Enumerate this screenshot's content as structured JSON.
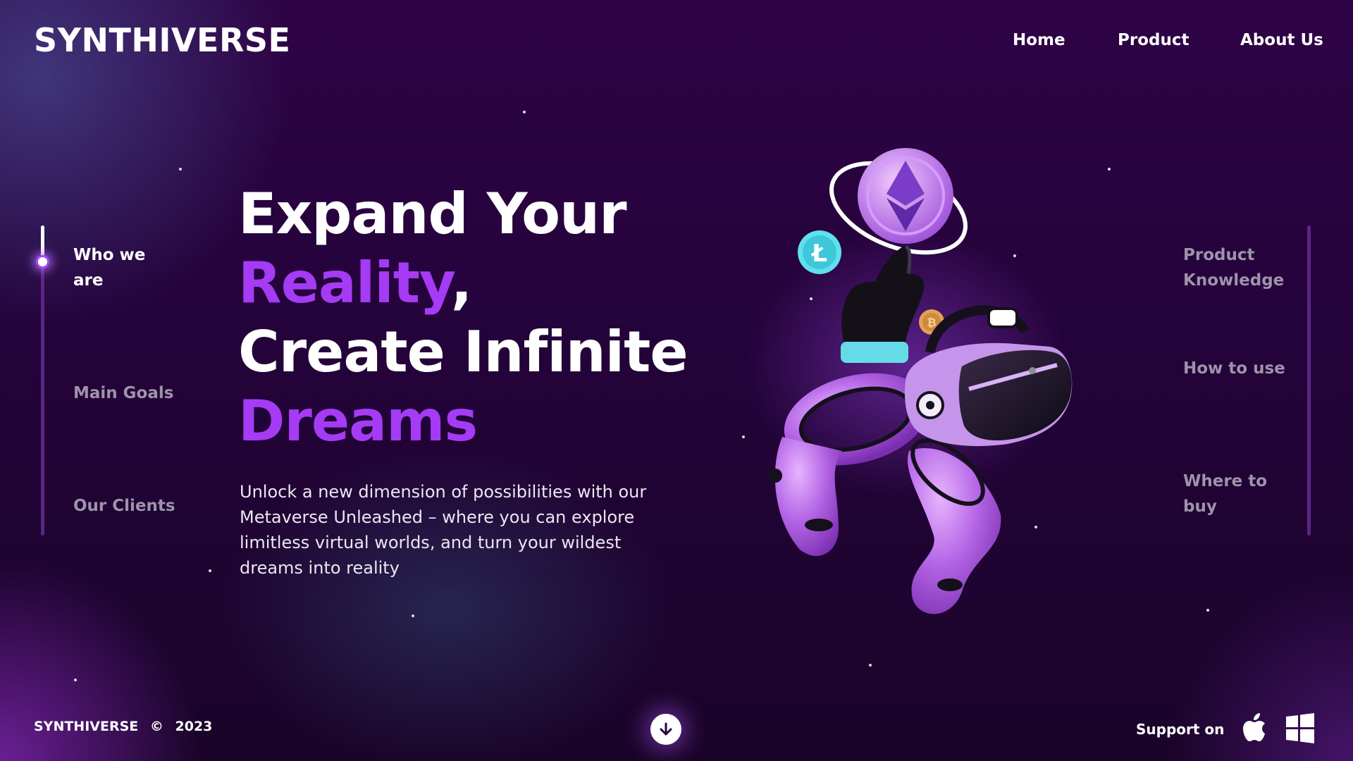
{
  "header": {
    "logo": "SYNTHIVERSE",
    "nav": [
      "Home",
      "Product",
      "About Us"
    ]
  },
  "left_sections": [
    {
      "label": "Who we are",
      "active": true
    },
    {
      "label": "Main Goals",
      "active": false
    },
    {
      "label": "Our Clients",
      "active": false
    }
  ],
  "right_sections": [
    {
      "label": "Product Knowledge"
    },
    {
      "label": "How to use"
    },
    {
      "label": "Where to buy"
    }
  ],
  "hero": {
    "line1": "Expand Your",
    "line2_accent": "Reality",
    "line2_suffix": ",",
    "line3": "Create Infinite",
    "line4_accent": "Dreams",
    "description": "Unlock a new dimension of possibilities with our Metaverse Unleashed – where you can explore limitless virtual worlds, and turn your wildest dreams into reality"
  },
  "footer": {
    "brand": "SYNTHIVERSE",
    "copyright_symbol": "©",
    "year": "2023",
    "support_label": "Support on",
    "platforms": [
      "apple-icon",
      "windows-icon"
    ]
  },
  "colors": {
    "accent": "#a53bf5",
    "background": "#2e0346",
    "rail": "#5b2586",
    "muted_text": "#9e93ab"
  }
}
